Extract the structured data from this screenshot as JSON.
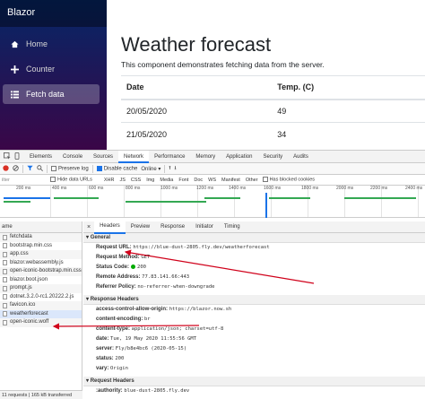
{
  "app": {
    "brand": "Blazor",
    "nav": [
      {
        "label": "Home",
        "icon": "home-icon"
      },
      {
        "label": "Counter",
        "icon": "plus-icon"
      },
      {
        "label": "Fetch data",
        "icon": "list-icon"
      }
    ],
    "title": "Weather forecast",
    "description": "This component demonstrates fetching data from the server.",
    "table": {
      "headers": [
        "Date",
        "Temp. (C)"
      ],
      "rows": [
        [
          "20/05/2020",
          "49"
        ],
        [
          "21/05/2020",
          "34"
        ]
      ]
    }
  },
  "devtools": {
    "tabs": [
      "Elements",
      "Console",
      "Sources",
      "Network",
      "Performance",
      "Memory",
      "Application",
      "Security",
      "Audits"
    ],
    "active_tab": "Network",
    "toolbar": {
      "preserve_log": "Preserve log",
      "disable_cache": "Disable cache",
      "throttle": "Online"
    },
    "filter": {
      "placeholder": "ilter",
      "hide_data_urls": "Hide data URLs",
      "types": [
        "XHR",
        "JS",
        "CSS",
        "Img",
        "Media",
        "Font",
        "Doc",
        "WS",
        "Manifest",
        "Other"
      ],
      "selected_type": "",
      "blocked_cookies": "Has blocked cookies"
    },
    "timeline_ticks": [
      "200 ms",
      "400 ms",
      "600 ms",
      "800 ms",
      "1000 ms",
      "1200 ms",
      "1400 ms",
      "1600 ms",
      "1800 ms",
      "2000 ms",
      "2200 ms",
      "2400 ms"
    ],
    "requests": {
      "column": "ame",
      "items": [
        "fetchdata",
        "bootstrap.min.css",
        "app.css",
        "blazor.webassembly.js",
        "open-iconic-bootstrap.min.css",
        "blazor.boot.json",
        "prompt.js",
        "dotnet.3.2.0-rc1.20222.2.js",
        "favicon.ico",
        "weatherforecast",
        "open-iconic.woff"
      ],
      "selected": "weatherforecast",
      "footer": "11 requests | 165 kB transferred"
    },
    "detail": {
      "close": "×",
      "tabs": [
        "Headers",
        "Preview",
        "Response",
        "Initiator",
        "Timing"
      ],
      "active_tab": "Headers",
      "general_title": "General",
      "general": [
        {
          "k": "Request URL:",
          "v": "https://blue-dust-2805.fly.dev/weatherforecast"
        },
        {
          "k": "Request Method:",
          "v": "GET"
        },
        {
          "k": "Status Code:",
          "v": "200"
        },
        {
          "k": "Remote Address:",
          "v": "77.83.141.66:443"
        },
        {
          "k": "Referrer Policy:",
          "v": "no-referrer-when-downgrade"
        }
      ],
      "response_title": "Response Headers",
      "response": [
        {
          "k": "access-control-allow-origin:",
          "v": "https://blazor.now.sh"
        },
        {
          "k": "content-encoding:",
          "v": "br"
        },
        {
          "k": "content-type:",
          "v": "application/json; charset=utf-8"
        },
        {
          "k": "date:",
          "v": "Tue, 19 May 2020 11:55:56 GMT"
        },
        {
          "k": "server:",
          "v": "Fly/b8e4bc6 (2020-05-15)"
        },
        {
          "k": "status:",
          "v": "200"
        },
        {
          "k": "vary:",
          "v": "Origin"
        }
      ],
      "request_title": "Request Headers",
      "request": [
        {
          "k": ":authority:",
          "v": "blue-dust-2805.fly.dev"
        }
      ]
    },
    "annotation_color": "#d0021b"
  }
}
